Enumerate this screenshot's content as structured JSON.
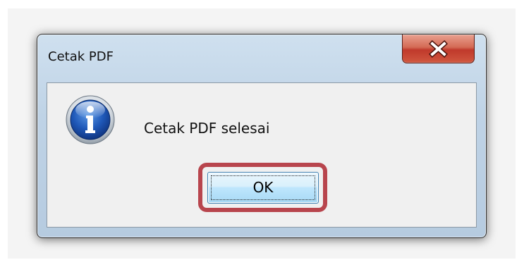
{
  "dialog": {
    "title": "Cetak PDF",
    "message": "Cetak PDF selesai",
    "icon": "info-icon",
    "ok_label": "OK",
    "close_icon": "close-icon"
  },
  "colors": {
    "highlight_outline": "#b8454d",
    "close_button": "#c0392b",
    "ok_button": "#bee6fd",
    "client_area": "#f0f0f0"
  }
}
